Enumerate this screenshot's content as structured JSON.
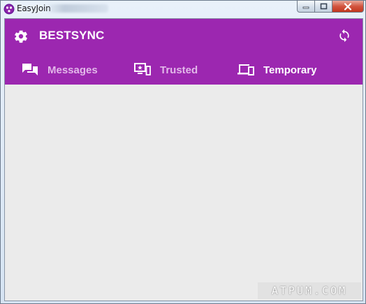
{
  "window": {
    "title": "EasyJoin"
  },
  "header": {
    "title": "BESTSYNC",
    "settings_icon": "gear-icon",
    "sync_icon": "sync-refresh-icon",
    "background_color": "#9c27b0"
  },
  "tabs": [
    {
      "label": "Messages",
      "icon": "chat-bubbles-icon",
      "active": false
    },
    {
      "label": "Trusted",
      "icon": "trusted-devices-icon",
      "active": false
    },
    {
      "label": "Temporary",
      "icon": "temporary-devices-icon",
      "active": true
    }
  ],
  "watermark": {
    "text": "ATPUM.COM"
  }
}
